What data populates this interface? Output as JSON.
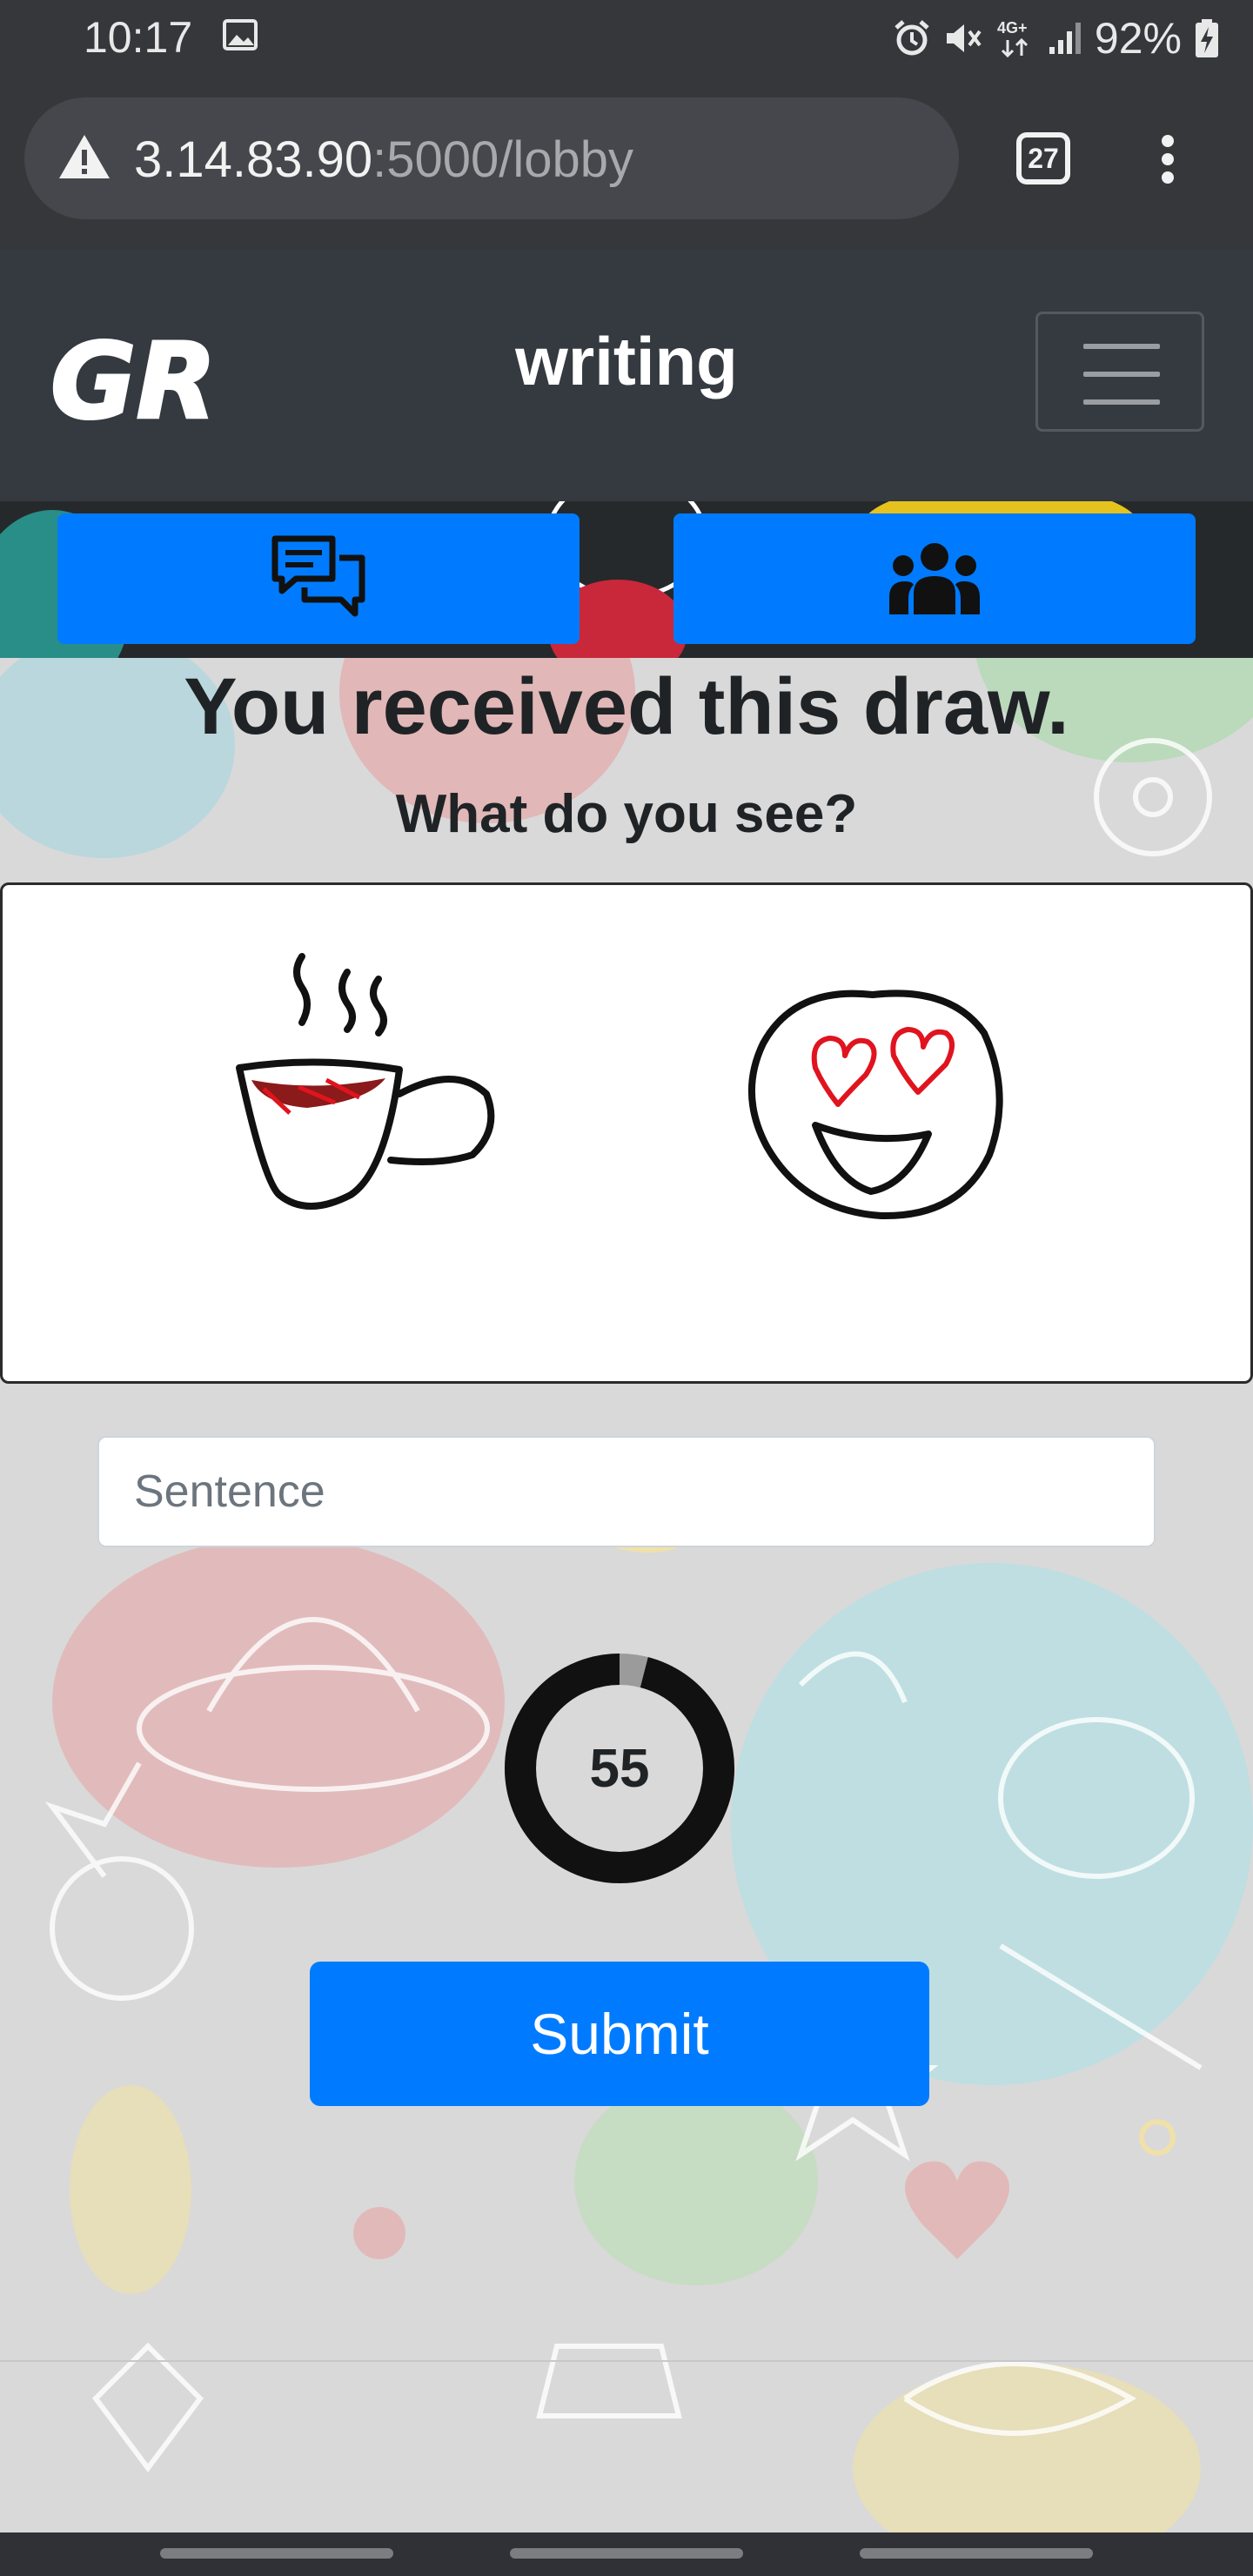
{
  "status_bar": {
    "time": "10:17",
    "network": "4G+",
    "battery": "92%",
    "icons": [
      "gallery-icon",
      "alarm-icon",
      "mute-icon",
      "network-4g-icon",
      "signal-icon",
      "battery-charging-icon"
    ]
  },
  "browser": {
    "url_host": "3.14.83.90",
    "url_path": ":5000/lobby",
    "tab_count": "27",
    "icons": [
      "warning-icon",
      "tabs-icon",
      "menu-kebab-icon"
    ]
  },
  "navbar": {
    "logo_text": "GR",
    "title": "writing"
  },
  "actions": {
    "chat_icon": "chat-bubbles-icon",
    "players_icon": "users-group-icon"
  },
  "main": {
    "heading": "You received this draw.",
    "subheading": "What do you see?",
    "drawing": [
      "steaming-cup",
      "heart-eyes-smiley"
    ],
    "sentence_placeholder": "Sentence",
    "sentence_value": "",
    "timer_value": "55",
    "timer_fraction_elapsed": 0.04,
    "submit_label": "Submit"
  },
  "colors": {
    "primary": "#007bff",
    "navbar": "#343a40",
    "drawing_red": "#e0141e"
  }
}
